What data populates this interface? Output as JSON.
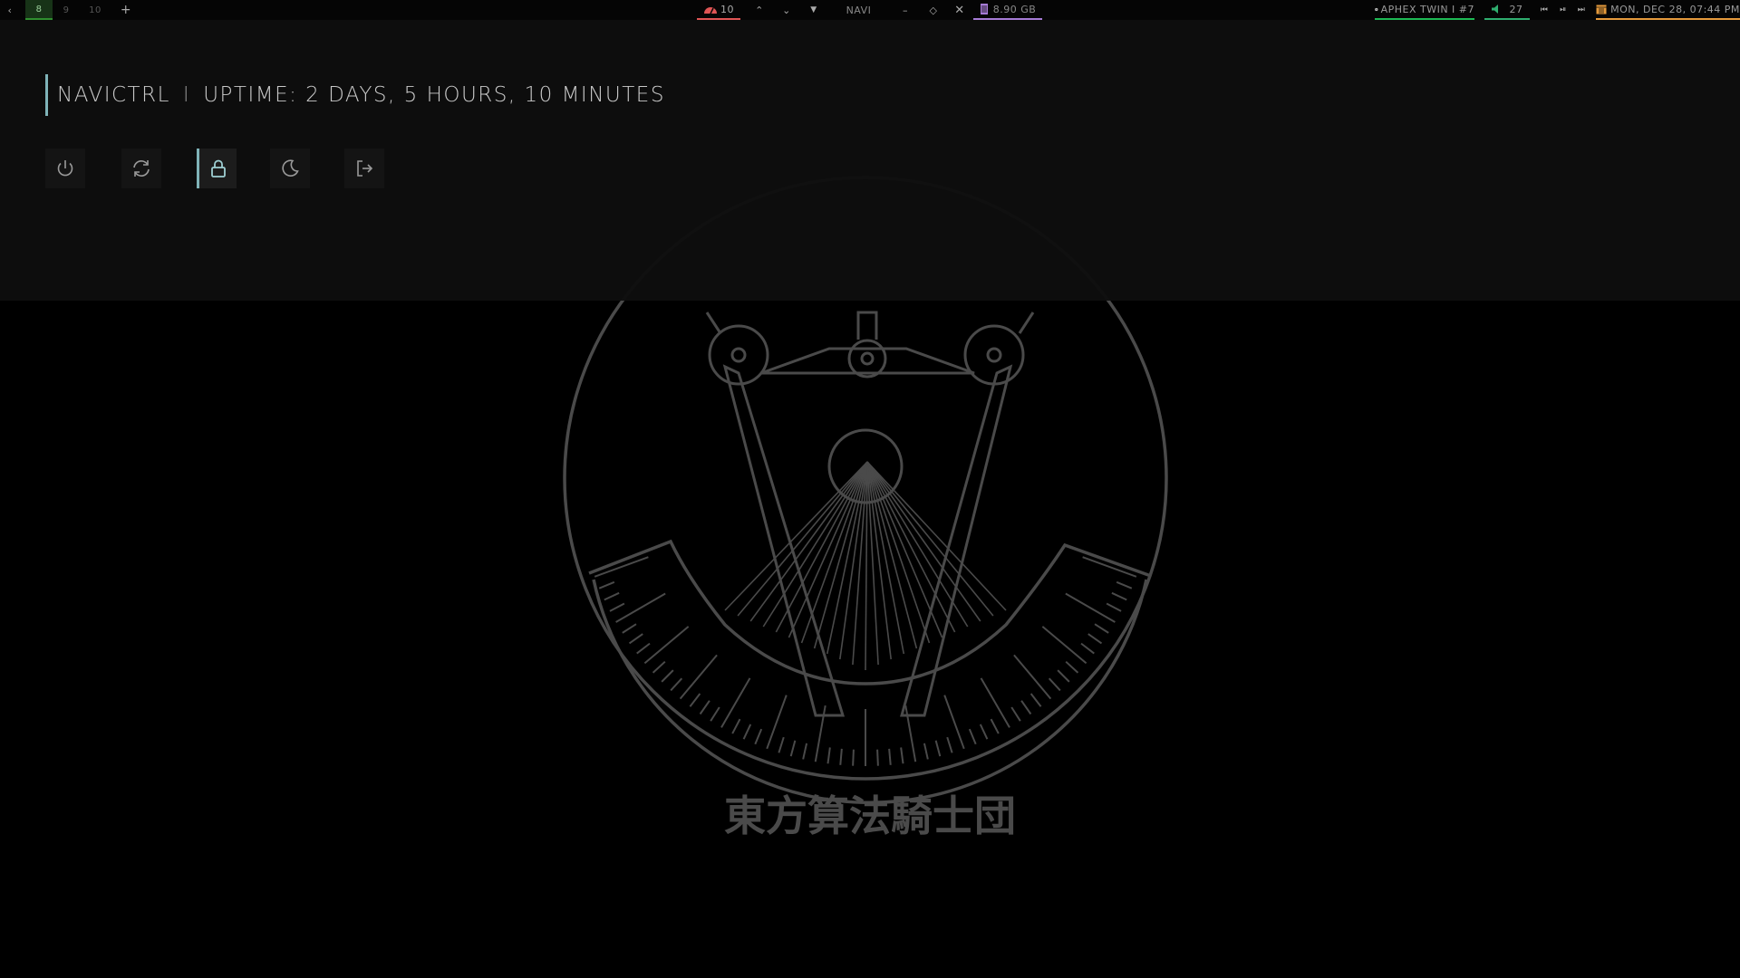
{
  "topbar": {
    "workspaces": [
      {
        "label": "8",
        "active": true
      },
      {
        "label": "9",
        "active": false
      },
      {
        "label": "10",
        "active": false
      }
    ],
    "cpu": {
      "label": "10",
      "icon": "speedometer-icon",
      "color": "#e05555"
    },
    "window_title": "NAVI",
    "memory": {
      "label": "8.90 GB",
      "icon": "memory-icon",
      "color": "#a67bd6"
    },
    "music": {
      "label": "APHEX TWIN I #7",
      "icon": "spotify-icon",
      "color": "#1db954"
    },
    "volume": {
      "label": "27",
      "icon": "speaker-icon",
      "color": "#2fae6f"
    },
    "clock": {
      "label": "MON, DEC 28, 07:44 PM",
      "icon": "calendar-icon",
      "color": "#e59a3c"
    }
  },
  "panel": {
    "app_name": "NAVICTRL",
    "separator": "I",
    "uptime": "UPTIME: 2 DAYS, 5 HOURS, 10 MINUTES",
    "buttons": [
      {
        "name": "shutdown",
        "icon": "power-icon"
      },
      {
        "name": "reboot",
        "icon": "refresh-icon"
      },
      {
        "name": "lock",
        "icon": "lock-icon",
        "selected": true
      },
      {
        "name": "suspend",
        "icon": "moon-icon"
      },
      {
        "name": "logout",
        "icon": "logout-icon"
      }
    ],
    "accent": "#7fb3b8"
  },
  "wallpaper": {
    "caption": "東方算法騎士団",
    "line_color": "#4a4a4a"
  }
}
